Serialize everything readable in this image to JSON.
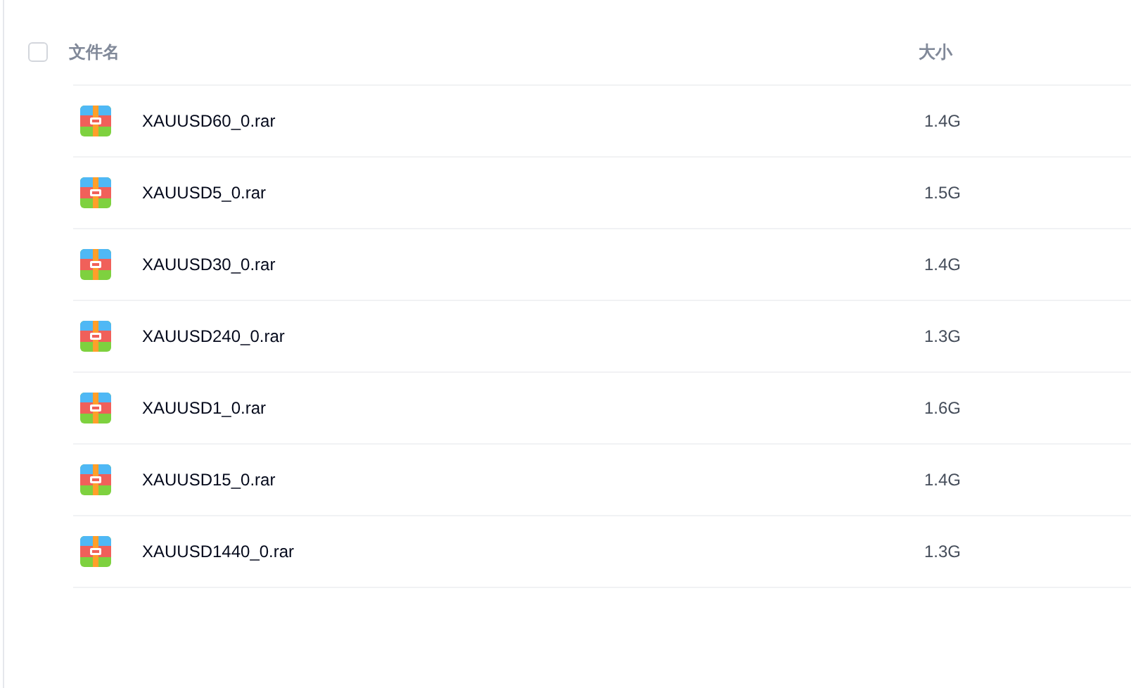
{
  "table": {
    "select_all": {
      "checked": false
    },
    "columns": [
      "文件名",
      "大小"
    ],
    "rows": [
      {
        "name": "XAUUSD60_0.rar",
        "size": "1.4G"
      },
      {
        "name": "XAUUSD5_0.rar",
        "size": "1.5G"
      },
      {
        "name": "XAUUSD30_0.rar",
        "size": "1.4G"
      },
      {
        "name": "XAUUSD240_0.rar",
        "size": "1.3G"
      },
      {
        "name": "XAUUSD1_0.rar",
        "size": "1.6G"
      },
      {
        "name": "XAUUSD15_0.rar",
        "size": "1.4G"
      },
      {
        "name": "XAUUSD1440_0.rar",
        "size": "1.3G"
      }
    ]
  }
}
